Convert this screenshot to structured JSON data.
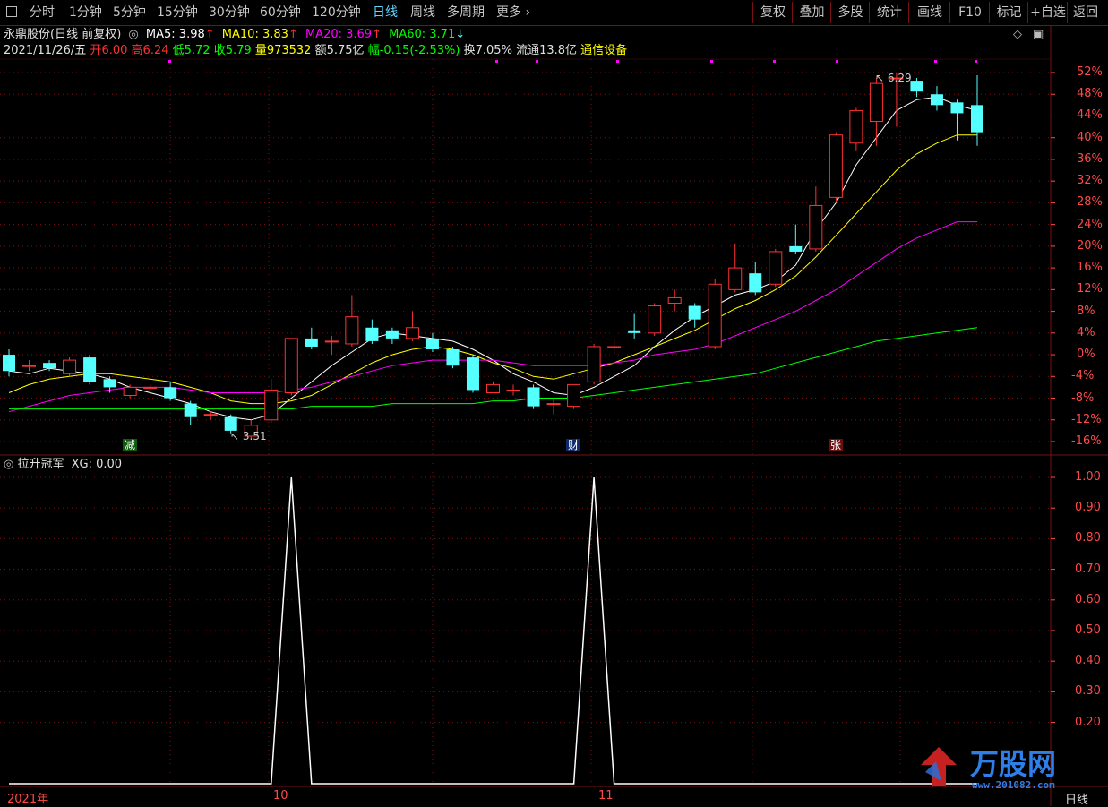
{
  "toolbar": {
    "periods": [
      "分时",
      "1分钟",
      "5分钟",
      "15分钟",
      "30分钟",
      "60分钟",
      "120分钟",
      "日线",
      "周线",
      "多周期",
      "更多"
    ],
    "active_period": "日线",
    "right_buttons": [
      "复权",
      "叠加",
      "多股",
      "统计",
      "画线",
      "F10",
      "标记",
      "+自选",
      "返回"
    ]
  },
  "stock": {
    "title": "永鼎股份(日线 前复权)",
    "ma5": "MA5: 3.98",
    "ma10": "MA10: 3.83",
    "ma20": "MA20: 3.69",
    "ma60": "MA60: 3.71",
    "date": "2021/11/26/五",
    "open": "开6.00",
    "high": "高6.24",
    "low": "低5.72",
    "close": "收5.79",
    "volume": "量973532",
    "amount": "额5.75亿",
    "change": "幅-0.15(-2.53%)",
    "turnover": "换7.05%",
    "float": "流通13.8亿",
    "sector": "通信设备"
  },
  "colors": {
    "up": "#ff3232",
    "down": "#54ffff",
    "ma5": "#ffffff",
    "ma10": "#ffff00",
    "ma20": "#ff00ff",
    "ma60": "#00ff00",
    "grid": "#7a1010",
    "axis": "#ff4a4a"
  },
  "price_axis": {
    "ticks": [
      "52%",
      "48%",
      "44%",
      "40%",
      "36%",
      "32%",
      "28%",
      "24%",
      "20%",
      "16%",
      "12%",
      "8%",
      "4%",
      "0%",
      "-4%",
      "-8%",
      "-12%",
      "-16%"
    ]
  },
  "annotations": {
    "high_label": "6.29",
    "low_label": "3.51",
    "markers": [
      "减",
      "财",
      "张"
    ]
  },
  "indicator": {
    "title": "拉升冠军",
    "value": "XG: 0.00",
    "ticks": [
      "1.00",
      "0.90",
      "0.80",
      "0.70",
      "0.60",
      "0.50",
      "0.40",
      "0.30",
      "0.20"
    ]
  },
  "chart_data": {
    "type": "candlestick",
    "y_unit": "%",
    "ylim": [
      -18,
      54
    ],
    "candles": [
      {
        "o": 0,
        "c": -3,
        "h": 1,
        "l": -4
      },
      {
        "o": -2,
        "c": -2,
        "h": -1,
        "l": -3
      },
      {
        "o": -1.5,
        "c": -2.5,
        "h": -1,
        "l": -3
      },
      {
        "o": -3.5,
        "c": -1,
        "h": -0.5,
        "l": -4
      },
      {
        "o": -0.5,
        "c": -5,
        "h": 0,
        "l": -5.5
      },
      {
        "o": -4.5,
        "c": -6,
        "h": -4,
        "l": -7
      },
      {
        "o": -7.5,
        "c": -6,
        "h": -5.5,
        "l": -8
      },
      {
        "o": -6,
        "c": -6,
        "h": -5.5,
        "l": -6.5
      },
      {
        "o": -6,
        "c": -8,
        "h": -5,
        "l": -8.5
      },
      {
        "o": -9,
        "c": -11.5,
        "h": -8.5,
        "l": -13
      },
      {
        "o": -11,
        "c": -11,
        "h": -10.5,
        "l": -12
      },
      {
        "o": -11.5,
        "c": -14,
        "h": -11,
        "l": -14.5
      },
      {
        "o": -15,
        "c": -13,
        "h": -12,
        "l": -15.5
      },
      {
        "o": -12,
        "c": -6.5,
        "h": -4.5,
        "l": -12.5
      },
      {
        "o": -7,
        "c": 3,
        "h": 3,
        "l": -7.5
      },
      {
        "o": 3,
        "c": 1.5,
        "h": 5,
        "l": 1
      },
      {
        "o": 2.5,
        "c": 2.5,
        "h": 3.5,
        "l": 0
      },
      {
        "o": 2,
        "c": 7,
        "h": 11,
        "l": 1.5
      },
      {
        "o": 5,
        "c": 2.5,
        "h": 6.5,
        "l": 2
      },
      {
        "o": 4.5,
        "c": 3,
        "h": 5,
        "l": 2
      },
      {
        "o": 3,
        "c": 5,
        "h": 8,
        "l": 2.5
      },
      {
        "o": 3,
        "c": 1,
        "h": 4,
        "l": 0.5
      },
      {
        "o": 1,
        "c": -2,
        "h": 1.5,
        "l": -2.5
      },
      {
        "o": -0.5,
        "c": -6.5,
        "h": 0,
        "l": -7
      },
      {
        "o": -7,
        "c": -5.5,
        "h": -5,
        "l": -7
      },
      {
        "o": -6.5,
        "c": -6.5,
        "h": -5.5,
        "l": -7.5
      },
      {
        "o": -6,
        "c": -9.5,
        "h": -5.5,
        "l": -10
      },
      {
        "o": -9,
        "c": -9,
        "h": -8,
        "l": -11
      },
      {
        "o": -9.5,
        "c": -5.5,
        "h": -5.5,
        "l": -10
      },
      {
        "o": -5,
        "c": 1.5,
        "h": 2,
        "l": -5.5
      },
      {
        "o": 1.5,
        "c": 1.5,
        "h": 3,
        "l": 0
      },
      {
        "o": 4.5,
        "c": 4,
        "h": 7.5,
        "l": 3
      },
      {
        "o": 4,
        "c": 9,
        "h": 9.5,
        "l": 3.5
      },
      {
        "o": 9.5,
        "c": 10.5,
        "h": 12,
        "l": 8
      },
      {
        "o": 9,
        "c": 6.5,
        "h": 9.5,
        "l": 5
      },
      {
        "o": 1.5,
        "c": 13,
        "h": 14,
        "l": 1
      },
      {
        "o": 12,
        "c": 16,
        "h": 20.5,
        "l": 11.5
      },
      {
        "o": 15,
        "c": 11.5,
        "h": 17,
        "l": 11
      },
      {
        "o": 13,
        "c": 19,
        "h": 19.5,
        "l": 12.5
      },
      {
        "o": 20,
        "c": 19,
        "h": 24,
        "l": 18.5
      },
      {
        "o": 19.5,
        "c": 27.5,
        "h": 31,
        "l": 19
      },
      {
        "o": 29,
        "c": 40.5,
        "h": 41,
        "l": 28
      },
      {
        "o": 39,
        "c": 45,
        "h": 45.5,
        "l": 37.5
      },
      {
        "o": 43,
        "c": 50,
        "h": 51,
        "l": 38.5
      },
      {
        "o": 51,
        "c": 51,
        "h": 52,
        "l": 42
      },
      {
        "o": 50.5,
        "c": 48.5,
        "h": 51,
        "l": 47.5
      },
      {
        "o": 48,
        "c": 46,
        "h": 49.5,
        "l": 45
      },
      {
        "o": 46.5,
        "c": 44.5,
        "h": 47,
        "l": 39.5
      },
      {
        "o": 46,
        "c": 41,
        "h": 51.5,
        "l": 38.5
      }
    ],
    "ma5": [
      -3,
      -3.5,
      -2.5,
      -3,
      -3.5,
      -4.5,
      -6,
      -7,
      -8,
      -9,
      -10.5,
      -11.5,
      -12,
      -11,
      -8,
      -5,
      -2,
      0.5,
      3,
      4,
      3.5,
      3,
      2.5,
      1,
      -1,
      -3.5,
      -5,
      -7,
      -7.5,
      -6,
      -4,
      -2,
      1.5,
      4.5,
      7,
      9,
      11,
      12,
      13.5,
      16.5,
      23,
      28,
      35,
      40,
      45,
      47,
      47.5,
      46,
      45
    ],
    "ma10": [
      -7,
      -5.5,
      -4.5,
      -4,
      -3.5,
      -3.5,
      -4,
      -4.5,
      -5,
      -6,
      -7,
      -8.5,
      -9,
      -9,
      -8.5,
      -7.5,
      -5.5,
      -3.5,
      -1.5,
      0,
      1,
      1.5,
      1,
      0,
      -1.5,
      -2.5,
      -4,
      -4.5,
      -3.5,
      -2.5,
      -1.5,
      0,
      1.5,
      3,
      4.5,
      6.5,
      8.5,
      10,
      12,
      14.5,
      18,
      22,
      26,
      30,
      34,
      37,
      39,
      40.5,
      40.5
    ],
    "ma20": [
      -10.5,
      -9.5,
      -8.5,
      -7.5,
      -7,
      -6.5,
      -6,
      -6,
      -6,
      -6.5,
      -7,
      -7,
      -7,
      -7,
      -6.5,
      -6,
      -5,
      -4,
      -3,
      -2,
      -1.5,
      -1,
      -1,
      -1,
      -1,
      -1.5,
      -2,
      -2,
      -2,
      -2,
      -1.5,
      -1,
      0,
      0.5,
      1,
      2,
      3.5,
      5,
      6.5,
      8,
      10,
      12,
      14.5,
      17,
      19.5,
      21.5,
      23,
      24.5,
      24.5
    ],
    "ma60": [
      -10,
      -10,
      -10,
      -10,
      -10,
      -10,
      -10,
      -10,
      -10,
      -10,
      -10,
      -10,
      -10,
      -10,
      -10,
      -9.5,
      -9.5,
      -9.5,
      -9.5,
      -9,
      -9,
      -9,
      -9,
      -9,
      -8.5,
      -8.5,
      -8,
      -8,
      -8,
      -7.5,
      -7,
      -6.5,
      -6,
      -5.5,
      -5,
      -4.5,
      -4,
      -3.5,
      -2.5,
      -1.5,
      -0.5,
      0.5,
      1.5,
      2.5,
      3,
      3.5,
      4,
      4.5,
      5
    ],
    "xg": [
      0,
      0,
      0,
      0,
      0,
      0,
      0,
      0,
      0,
      0,
      0,
      0,
      0,
      0,
      1,
      0,
      0,
      0,
      0,
      0,
      0,
      0,
      0,
      0,
      0,
      0,
      0,
      0,
      0,
      1,
      0,
      0,
      0,
      0,
      0,
      0,
      0,
      0,
      0,
      0,
      0,
      0,
      0,
      0,
      0,
      0,
      0,
      0,
      0
    ],
    "date_labels": [
      "2021年",
      "10",
      "11"
    ]
  },
  "watermark": {
    "text": "万股网",
    "url": "www.201082.com"
  },
  "footer_period": "日线"
}
